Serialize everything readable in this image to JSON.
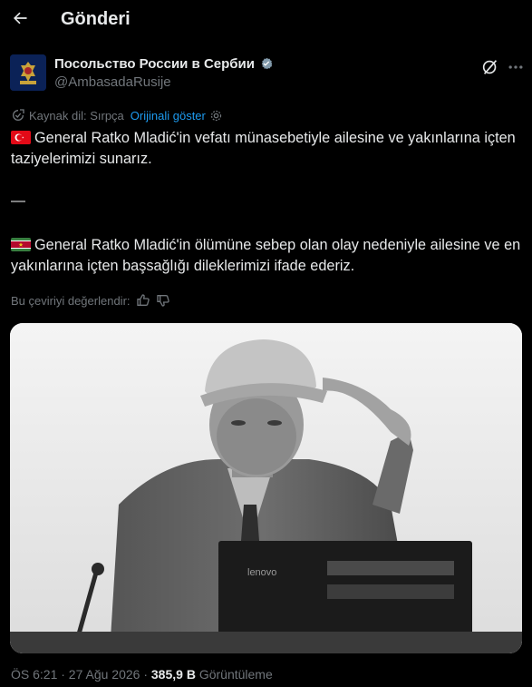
{
  "header": {
    "title": "Gönderi",
    "back_icon": "arrow-left-icon"
  },
  "author": {
    "name": "Посольство России в Сербии",
    "handle": "@AmbasadaRusije",
    "verified": true,
    "verified_color": "#829aab"
  },
  "translation": {
    "source": "Kaynak dil: Sırpça",
    "show_original": "Orijinali göster"
  },
  "post": {
    "flag1": "Turkey flag",
    "paragraph1": "General Ratko Mladić'in vefatı münasebetiyle ailesine ve yakınlarına içten taziyelerimizi sunarız.",
    "separator": "—",
    "flag2": "Suriname flag",
    "paragraph2": "General Ratko Mladić'in ölümüne sebep olan olay nedeniyle ailesine ve en yakınlarına içten başsağlığı dileklerimizi ifade ederiz."
  },
  "rating": {
    "label": "Bu çeviriyi değerlendir:"
  },
  "image": {
    "monitor_brand": "lenovo"
  },
  "meta": {
    "time": "ÖS 6:21 · 27 Ağu 2026 · ",
    "views": "385,9 B",
    "views_label": " Görüntüleme"
  },
  "colors": {
    "accent": "#1d9bf0",
    "muted": "#71767b",
    "text": "#e7e9ea",
    "background": "#000000"
  }
}
